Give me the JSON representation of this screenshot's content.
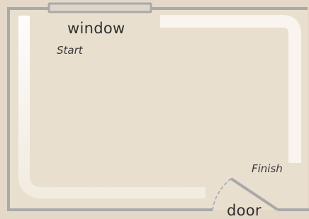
{
  "labels": {
    "window": "window",
    "start": "Start",
    "finish": "Finish",
    "door": "door"
  },
  "colors": {
    "background": "#e4d9c8",
    "room_fill": "#e9dfcf",
    "wall": "#a9a9ab",
    "window_fill": "#ddd5c8",
    "path": "#fbf8f2",
    "door_swing": "#a9a9ab"
  }
}
